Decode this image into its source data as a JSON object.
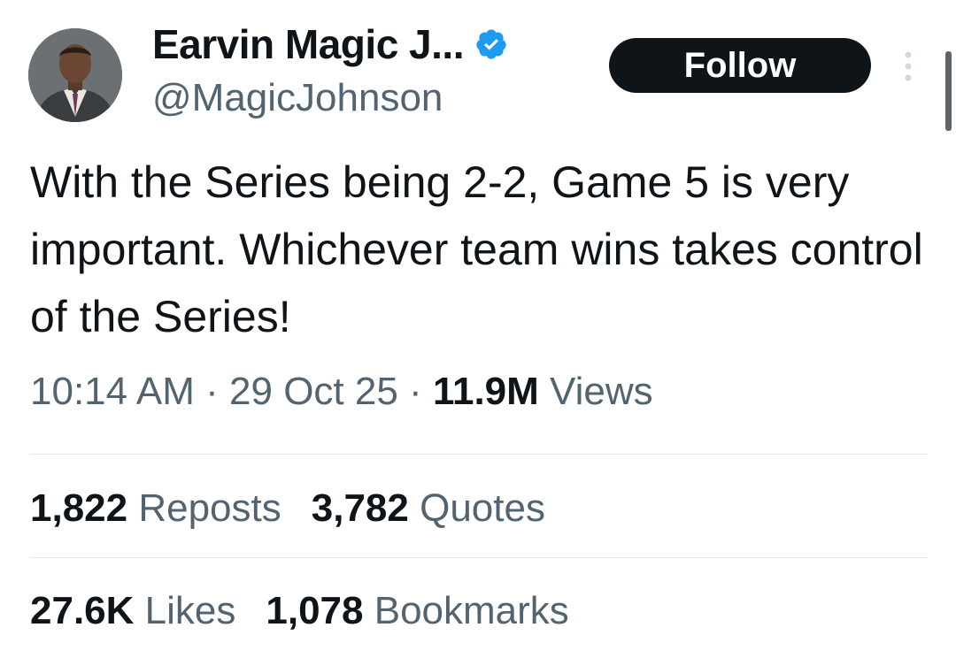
{
  "author": {
    "display_name": "Earvin Magic J...",
    "handle": "@MagicJohnson",
    "verified_icon": "verified-badge-icon"
  },
  "header": {
    "follow_label": "Follow",
    "more_icon": "more-vertical-icon"
  },
  "tweet": {
    "text": "With the Series being 2-2, Game 5 is very important. Whichever team wins takes control of the Series!",
    "time": "10:14 AM",
    "separator": "·",
    "date": "29 Oct 25",
    "views_count": "11.9M",
    "views_label": "Views"
  },
  "stats": {
    "reposts_count": "1,822",
    "reposts_label": "Reposts",
    "quotes_count": "3,782",
    "quotes_label": "Quotes",
    "likes_count": "27.6K",
    "likes_label": "Likes",
    "bookmarks_count": "1,078",
    "bookmarks_label": "Bookmarks"
  },
  "colors": {
    "verified_blue": "#1d9bf0",
    "text_primary": "#0f1419",
    "text_secondary": "#536471",
    "divider": "#e1e8ed"
  }
}
